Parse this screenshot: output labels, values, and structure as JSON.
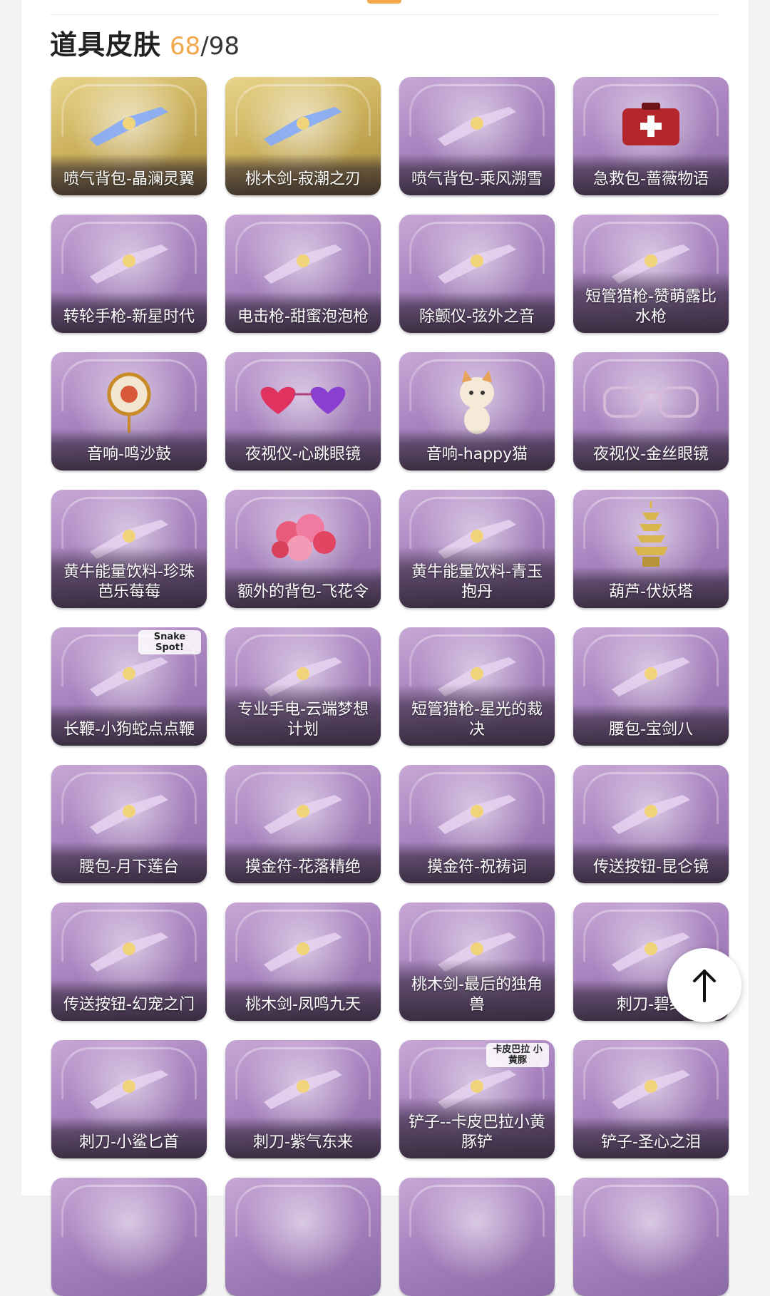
{
  "header": {
    "title": "道具皮肤",
    "owned": "68",
    "separator": "/",
    "total": "98"
  },
  "items": [
    {
      "label": "喷气背包-晶澜灵翼",
      "icon": "wings-jetpack-icon",
      "frame": "gold"
    },
    {
      "label": "桃木剑-寂潮之刃",
      "icon": "sword-icon",
      "frame": "gold"
    },
    {
      "label": "喷气背包-乘风溯雪",
      "icon": "jetpack-icon",
      "frame": "purple"
    },
    {
      "label": "急救包-蔷薇物语",
      "icon": "first-aid-kit-icon",
      "frame": "purple"
    },
    {
      "label": "转轮手枪-新星时代",
      "icon": "revolver-icon",
      "frame": "purple"
    },
    {
      "label": "电击枪-甜蜜泡泡枪",
      "icon": "bubble-gun-icon",
      "frame": "purple"
    },
    {
      "label": "除颤仪-弦外之音",
      "icon": "lute-icon",
      "frame": "purple"
    },
    {
      "label": "短管猎枪-赞萌露比水枪",
      "icon": "water-gun-icon",
      "frame": "purple"
    },
    {
      "label": "音响-鸣沙鼓",
      "icon": "drum-icon",
      "frame": "purple"
    },
    {
      "label": "夜视仪-心跳眼镜",
      "icon": "heart-glasses-icon",
      "frame": "purple"
    },
    {
      "label": "音响-happy猫",
      "icon": "cat-icon",
      "frame": "purple"
    },
    {
      "label": "夜视仪-金丝眼镜",
      "icon": "glasses-icon",
      "frame": "purple"
    },
    {
      "label": "黄牛能量饮料-珍珠芭乐莓莓",
      "icon": "drink-cup-icon",
      "frame": "purple"
    },
    {
      "label": "额外的背包-飞花令",
      "icon": "flower-bouquet-icon",
      "frame": "purple"
    },
    {
      "label": "黄牛能量饮料-青玉抱丹",
      "icon": "jade-bottle-icon",
      "frame": "purple"
    },
    {
      "label": "葫芦-伏妖塔",
      "icon": "pagoda-icon",
      "frame": "purple"
    },
    {
      "label": "长鞭-小狗蛇点点鞭",
      "icon": "snake-whip-icon",
      "frame": "purple",
      "badge": "Snake Spot!"
    },
    {
      "label": "专业手电-云端梦想计划",
      "icon": "flashlight-icon",
      "frame": "purple"
    },
    {
      "label": "短管猎枪-星光的裁决",
      "icon": "shotgun-icon",
      "frame": "purple"
    },
    {
      "label": "腰包-宝剑八",
      "icon": "heart-pouch-icon",
      "frame": "purple"
    },
    {
      "label": "腰包-月下莲台",
      "icon": "lotus-pouch-icon",
      "frame": "purple"
    },
    {
      "label": "摸金符-花落精绝",
      "icon": "amulet-flower-icon",
      "frame": "purple"
    },
    {
      "label": "摸金符-祝祷词",
      "icon": "amulet-icon",
      "frame": "purple"
    },
    {
      "label": "传送按钮-昆仑镜",
      "icon": "mirror-icon",
      "frame": "purple"
    },
    {
      "label": "传送按钮-幻宠之门",
      "icon": "rainbow-door-icon",
      "frame": "purple"
    },
    {
      "label": "桃木剑-凤鸣九天",
      "icon": "red-sword-icon",
      "frame": "purple"
    },
    {
      "label": "桃木剑-最后的独角兽",
      "icon": "unicorn-horn-icon",
      "frame": "purple"
    },
    {
      "label": "刺刀-碧络",
      "icon": "dagger-icon",
      "frame": "purple"
    },
    {
      "label": "刺刀-小鲨匕首",
      "icon": "shark-dagger-icon",
      "frame": "purple"
    },
    {
      "label": "刺刀-紫气东来",
      "icon": "purple-blade-icon",
      "frame": "purple"
    },
    {
      "label": "铲子--卡皮巴拉小黄豚铲",
      "icon": "shovel-icon",
      "frame": "purple",
      "badge": "卡皮巴拉 小黄豚"
    },
    {
      "label": "铲子-圣心之泪",
      "icon": "scepter-icon",
      "frame": "purple"
    }
  ],
  "back_to_top": {
    "icon": "arrow-up-icon"
  }
}
